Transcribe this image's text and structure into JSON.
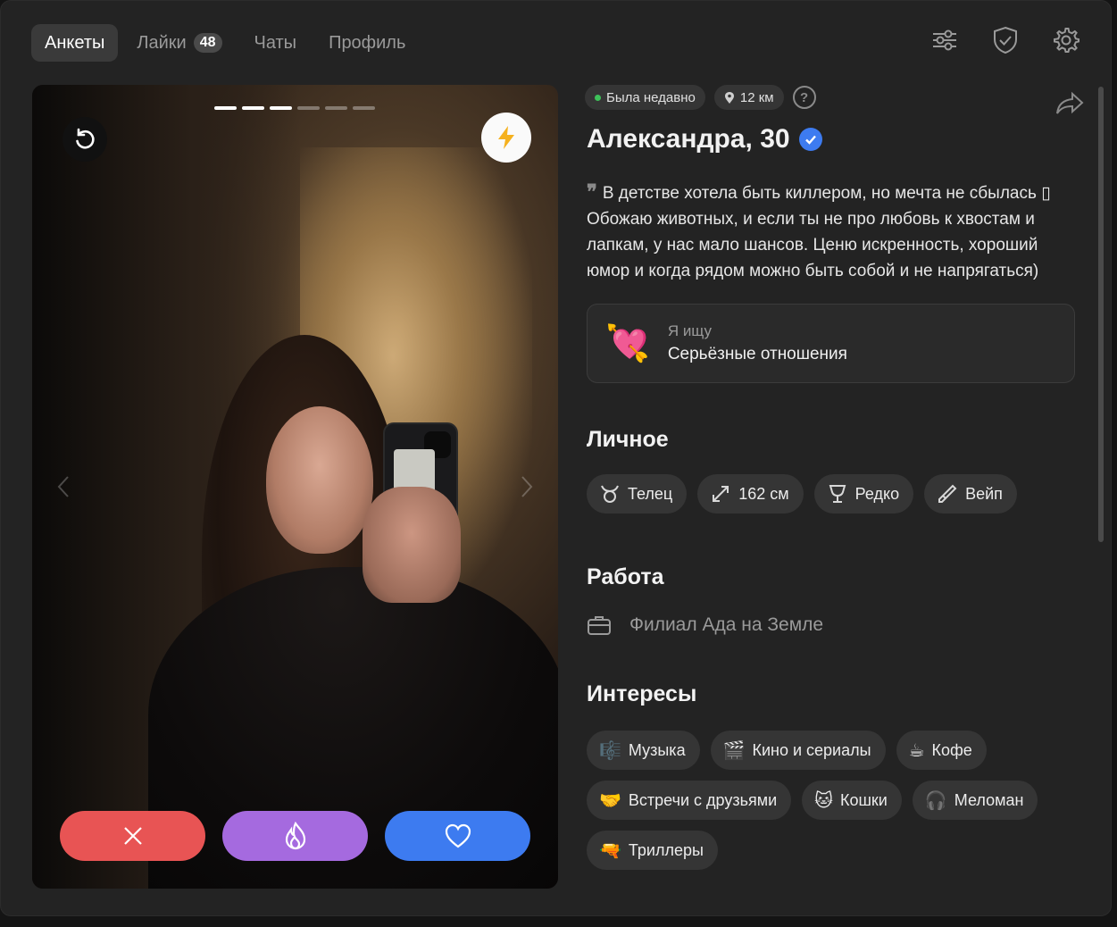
{
  "nav": {
    "tabs": [
      {
        "label": "Анкеты",
        "active": true
      },
      {
        "label": "Лайки",
        "badge": "48"
      },
      {
        "label": "Чаты"
      },
      {
        "label": "Профиль"
      }
    ],
    "icons": [
      "sliders-icon",
      "shield-check-icon",
      "gear-icon"
    ]
  },
  "photo": {
    "total_photos": 6,
    "current_photo": 3
  },
  "profile": {
    "status": "Была недавно",
    "distance": "12 км",
    "help": "?",
    "name": "Александра, 30",
    "verified": true,
    "bio_quote": "❞",
    "bio": "В детстве хотела быть киллером, но мечта не сбылась ▯ Обожаю животных, и если ты не про любовь к хвостам и лапкам, у нас мало шансов. Ценю искренность, хороший юмор и когда рядом можно быть собой и не напрягаться)",
    "seeking": {
      "emoji": "💘",
      "label": "Я ищу",
      "value": "Серьёзные отношения"
    }
  },
  "personal": {
    "title": "Личное",
    "items": [
      {
        "icon": "taurus-icon",
        "label": "Телец"
      },
      {
        "icon": "height-icon",
        "label": "162 см"
      },
      {
        "icon": "drink-icon",
        "label": "Редко"
      },
      {
        "icon": "vape-icon",
        "label": "Вейп"
      }
    ]
  },
  "work": {
    "title": "Работа",
    "value": "Филиал Ада на Земле"
  },
  "interests": {
    "title": "Интересы",
    "items": [
      {
        "emoji": "🎼",
        "label": "Музыка"
      },
      {
        "emoji": "🎬",
        "label": "Кино и сериалы"
      },
      {
        "emoji": "☕",
        "label": "Кофе"
      },
      {
        "emoji": "🤝",
        "label": "Встречи с друзьями"
      },
      {
        "emoji": "🐱",
        "label": "Кошки"
      },
      {
        "emoji": "🎧",
        "label": "Меломан"
      },
      {
        "emoji": "🔫",
        "label": "Триллеры"
      }
    ]
  },
  "colors": {
    "dislike": "#e85454",
    "superlike": "#a56adf",
    "like": "#3d7bf0",
    "online": "#3ec25a",
    "verified": "#3d7bf0"
  }
}
